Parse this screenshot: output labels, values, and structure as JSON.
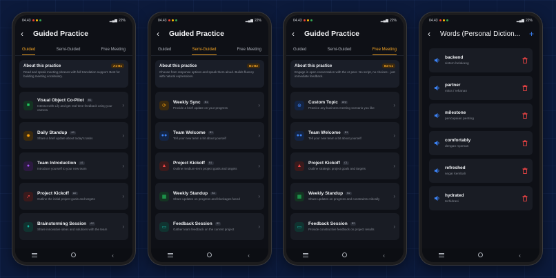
{
  "status": {
    "time": "04.43",
    "battery": "22%"
  },
  "icons": {
    "back": "arrow-left-icon",
    "chevron": "chevron-right-icon",
    "speaker": "speaker-icon",
    "trash": "trash-icon",
    "plus": "plus-icon"
  },
  "colors": {
    "accent": "#f5a524",
    "blue": "#3b82f6",
    "delete": "#ef4444"
  },
  "tabs": [
    "Guided",
    "Semi-Guided",
    "Free Meeting"
  ],
  "phones": [
    {
      "title": "Guided Practice",
      "active_tab": 0,
      "about": {
        "title": "About this practice",
        "level": "A1-B1",
        "desc": "Read and speak meeting phrases with full translation support. Best for building meeting vocabulary."
      },
      "cards": [
        {
          "title": "Visual Object Co-Pilot",
          "level": "B1",
          "desc": "Interact with Lily and get real-time feedback using your camera",
          "icon": "video-camera-icon",
          "icon_color": "#22c55e",
          "icon_bg": "#143322",
          "glyph": "■"
        },
        {
          "title": "Daily Standup",
          "level": "A1",
          "desc": "Share a brief update about today's tasks",
          "icon": "sun-icon",
          "icon_color": "#f59e0b",
          "icon_bg": "#3a2a10",
          "glyph": "✹"
        },
        {
          "title": "Team Introduction",
          "level": "A1",
          "desc": "Introduce yourself to your new team",
          "icon": "team-icon",
          "icon_color": "#a855f7",
          "icon_bg": "#2c1a40",
          "glyph": "●"
        },
        {
          "title": "Project Kickoff",
          "level": "A2",
          "desc": "Outline the initial project goals and targets",
          "icon": "rocket-icon",
          "icon_color": "#ef4444",
          "icon_bg": "#3a1a1c",
          "glyph": "➚"
        },
        {
          "title": "Brainstorming Session",
          "level": "A2",
          "desc": "Share innovative ideas and solutions with the team",
          "icon": "lightbulb-icon",
          "icon_color": "#14b8a6",
          "icon_bg": "#103330",
          "glyph": "♦"
        }
      ]
    },
    {
      "title": "Guided Practice",
      "active_tab": 1,
      "about": {
        "title": "About this practice",
        "level": "B1-B2",
        "desc": "Choose from response options and speak them aloud. Builds fluency with natural expressions."
      },
      "cards": [
        {
          "title": "Weekly Sync",
          "level": "B1",
          "desc": "Provide a brief update on your progress",
          "icon": "sync-icon",
          "icon_color": "#f59e0b",
          "icon_bg": "#3a2a10",
          "glyph": "⟳"
        },
        {
          "title": "Team Welcome",
          "level": "B1",
          "desc": "Tell your new team a bit about yourself",
          "icon": "people-icon",
          "icon_color": "#3b82f6",
          "icon_bg": "#142443",
          "glyph": "●●"
        },
        {
          "title": "Project Kickoff",
          "level": "B1",
          "desc": "Outline medium-term project goals and targets",
          "icon": "rocket-icon",
          "icon_color": "#ef4444",
          "icon_bg": "#3a1a1c",
          "glyph": "▲"
        },
        {
          "title": "Weekly Standup",
          "level": "B1",
          "desc": "Share updates on progress and blockages faced",
          "icon": "calendar-icon",
          "icon_color": "#22c55e",
          "icon_bg": "#143322",
          "glyph": "▦"
        },
        {
          "title": "Feedback Session",
          "level": "B2",
          "desc": "Gather team feedback on the current project",
          "icon": "chat-icon",
          "icon_color": "#14b8a6",
          "icon_bg": "#103330",
          "glyph": "▭"
        }
      ]
    },
    {
      "title": "Guided Practice",
      "active_tab": 2,
      "about": {
        "title": "About this practice",
        "level": "B2-C1",
        "desc": "Engage in open conversation with the AI peer. No script, no choices - just immediate feedback."
      },
      "cards": [
        {
          "title": "Custom Topic",
          "level": "Any",
          "desc": "Practice any business meeting scenario you like",
          "icon": "plus-circle-icon",
          "icon_color": "#3b82f6",
          "icon_bg": "#142443",
          "glyph": "⊕"
        },
        {
          "title": "Team Welcome",
          "level": "B1",
          "desc": "Tell your new team a bit about yourself",
          "icon": "people-icon",
          "icon_color": "#3b82f6",
          "icon_bg": "#142443",
          "glyph": "●●"
        },
        {
          "title": "Project Kickoff",
          "level": "C1",
          "desc": "Outline strategic project goals and targets",
          "icon": "rocket-icon",
          "icon_color": "#ef4444",
          "icon_bg": "#3a1a1c",
          "glyph": "▲"
        },
        {
          "title": "Weekly Standup",
          "level": "B2",
          "desc": "Share updates on progress and constraints critically",
          "icon": "calendar-icon",
          "icon_color": "#22c55e",
          "icon_bg": "#143322",
          "glyph": "▦"
        },
        {
          "title": "Feedback Session",
          "level": "B2",
          "desc": "Provide constructive feedback on project results",
          "icon": "chat-icon",
          "icon_color": "#14b8a6",
          "icon_bg": "#103330",
          "glyph": "▭"
        }
      ]
    }
  ],
  "dictionary": {
    "title": "Words (Personal Diction...",
    "words": [
      {
        "word": "backend",
        "translation": "sistem belakang"
      },
      {
        "word": "partner",
        "translation": "mitra / rekanan"
      },
      {
        "word": "milestone",
        "translation": "pencapaian penting"
      },
      {
        "word": "comfortably",
        "translation": "dengan nyaman"
      },
      {
        "word": "refreshed",
        "translation": "segar kembali"
      },
      {
        "word": "hydrated",
        "translation": "terhidrasi"
      }
    ]
  }
}
